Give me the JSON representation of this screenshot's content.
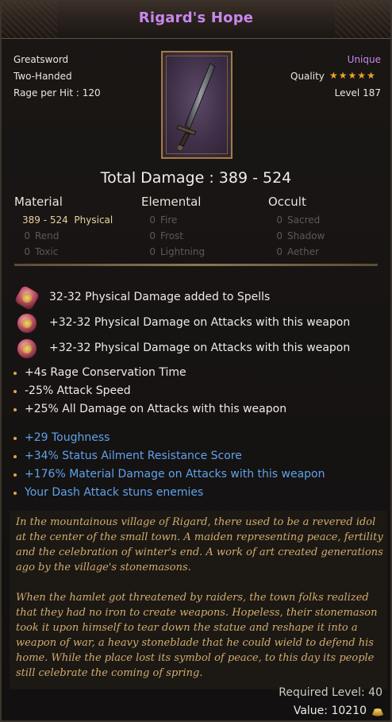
{
  "title": "Rigard's Hope",
  "left_info": [
    "Greatsword",
    "Two-Handed",
    "Rage per Hit : 120"
  ],
  "rarity": "Unique",
  "quality_label": "Quality",
  "quality_stars": 5,
  "level": "Level 187",
  "total_damage": "Total Damage : 389 - 524",
  "columns": {
    "material": {
      "header": "Material",
      "rows": [
        {
          "value": "389 - 524",
          "name": "Physical",
          "active": true
        },
        {
          "value": "0",
          "name": "Rend",
          "active": false
        },
        {
          "value": "0",
          "name": "Toxic",
          "active": false
        }
      ]
    },
    "elemental": {
      "header": "Elemental",
      "rows": [
        {
          "value": "0",
          "name": "Fire",
          "active": false
        },
        {
          "value": "0",
          "name": "Frost",
          "active": false
        },
        {
          "value": "0",
          "name": "Lightning",
          "active": false
        }
      ]
    },
    "occult": {
      "header": "Occult",
      "rows": [
        {
          "value": "0",
          "name": "Sacred",
          "active": false
        },
        {
          "value": "0",
          "name": "Shadow",
          "active": false
        },
        {
          "value": "0",
          "name": "Aether",
          "active": false
        }
      ]
    }
  },
  "gem_mods": [
    "32-32 Physical Damage added to Spells",
    "+32-32 Physical Damage on Attacks with this weapon",
    "+32-32 Physical Damage on Attacks with this weapon"
  ],
  "base_mods": [
    "+4s Rage Conservation Time",
    "-25% Attack Speed",
    "+25% All Damage on Attacks with this weapon"
  ],
  "unique_mods": [
    "+29 Toughness",
    "+34% Status Ailment Resistance Score",
    "+176% Material Damage on Attacks with this weapon",
    "Your Dash Attack stuns enemies"
  ],
  "lore": [
    "In the mountainous village of Rigard, there used to be a revered idol at the center of the small town. A maiden representing peace, fertility and the celebration of winter's end. A work of art created generations ago by the village's stonemasons.",
    "When the hamlet got threatened by raiders, the town folks realized that they had no iron to create weapons. Hopeless, their stonemason took it upon himself to tear down the statue and reshape it into a weapon of war, a heavy stoneblade that he could wield to defend his home. While the place lost its symbol of peace, to this day its people still celebrate the coming of spring."
  ],
  "required_level": "Required Level: 40",
  "value": "Value: 10210",
  "colors": {
    "rarity": "#c787ee",
    "unique_mod": "#5fa2ea",
    "lore": "#d1ac6e",
    "star": "#e7a526"
  }
}
